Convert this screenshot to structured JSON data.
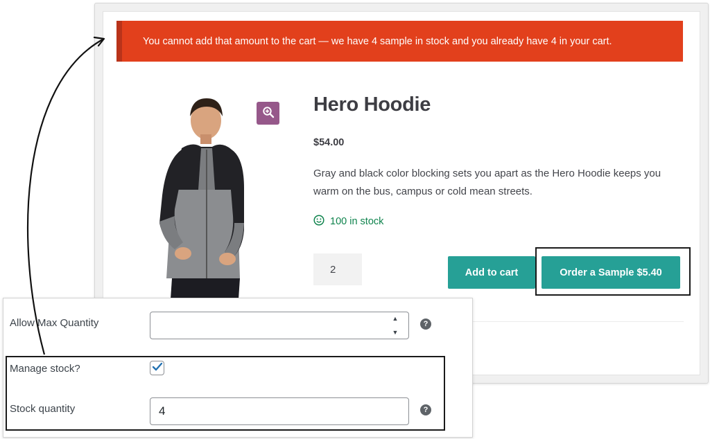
{
  "notice": {
    "message": "You cannot add that amount to the cart — we have 4 sample in stock and you already have 4 in your cart.",
    "color": "#e2401c"
  },
  "product": {
    "title": "Hero Hoodie",
    "price": "$54.00",
    "description": "Gray and black color blocking sets you apart as the Hero Hoodie keeps you warm on the bus, campus or cold mean streets.",
    "stock": "100 in stock",
    "quantity": "2",
    "add_to_cart": "Add to cart",
    "order_sample": "Order a Sample $5.40",
    "button_color": "#26a096",
    "zoom_icon": "zoom-in-icon"
  },
  "settings": {
    "max_quantity_label": "Allow Max Quantity",
    "max_quantity_value": "",
    "manage_stock_label": "Manage stock?",
    "manage_stock_checked": true,
    "stock_quantity_label": "Stock quantity",
    "stock_quantity_value": "4",
    "help_icon": "help-icon"
  }
}
